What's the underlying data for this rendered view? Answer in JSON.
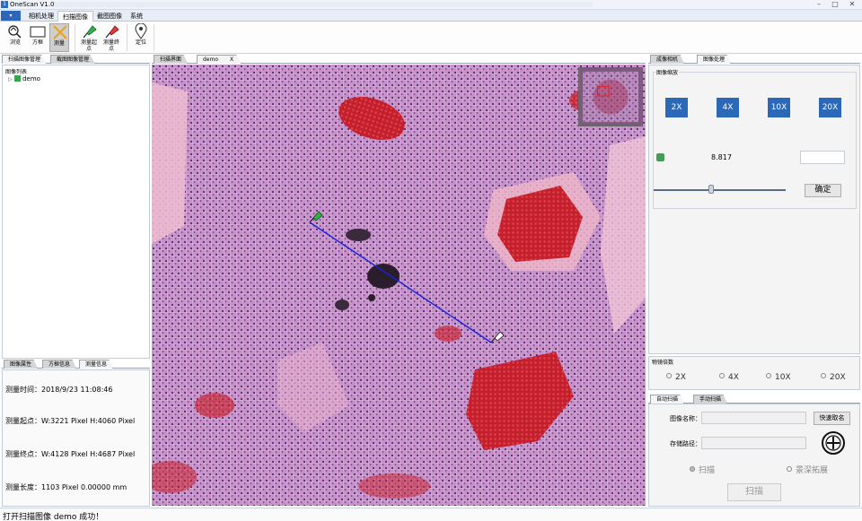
{
  "window": {
    "title": "OneScan V1.0"
  },
  "ribbon": {
    "tabs": [
      "相机处理",
      "扫描图像",
      "截图图像",
      "系统"
    ],
    "active_tab": "扫描图像",
    "tools": [
      {
        "label": "浏览",
        "icon": "browse-icon"
      },
      {
        "label": "方框",
        "icon": "rectangle-icon"
      },
      {
        "label": "测量",
        "icon": "measure-icon"
      },
      {
        "label": "测量起点",
        "icon": "measure-start-pin-icon"
      },
      {
        "label": "测量终点",
        "icon": "measure-end-pin-icon"
      },
      {
        "label": "定位",
        "icon": "location-pin-icon"
      }
    ],
    "active_tool": "测量"
  },
  "left_panel": {
    "tabs": [
      "扫描图像管理",
      "截图图像管理"
    ],
    "tree_header": "图像列表",
    "tree_items": [
      {
        "label": "demo"
      }
    ],
    "info_tabs": [
      "图像属性",
      "方框信息",
      "测量信息"
    ],
    "info": {
      "time": "测量时间：2018/9/23 11:08:46",
      "start": "测量起点：W:3221 Pixel  H:4060 Pixel",
      "end": "测量终点：W:4128 Pixel  H:4687 Pixel",
      "length": "测量长度：1103 Pixel  0.00000 mm"
    }
  },
  "viewer": {
    "tabs": [
      "扫描界面",
      "demo"
    ],
    "close": "X"
  },
  "right_panel": {
    "tabs": [
      "成像相机",
      "图像处理"
    ],
    "zoom_group": "图像缩放",
    "zoom_buttons": [
      "2X",
      "4X",
      "10X",
      "20X"
    ],
    "zoom_value": "8.817",
    "confirm": "确定",
    "objective_group": "物镜倍数",
    "objective_options": [
      "2X",
      "4X",
      "10X",
      "20X"
    ],
    "scan_tabs": [
      "自动扫描",
      "手动扫描"
    ],
    "image_name_label": "图像名称：",
    "quick_name": "快速取名",
    "save_path_label": "存储路径：",
    "mode_options": [
      "扫描",
      "景深拓展"
    ],
    "scan_button": "扫描"
  },
  "status": {
    "text": "打开扫描图像 demo 成功！"
  },
  "colors": {
    "accent": "#2b68b8",
    "measure_line": "#1a22d8"
  }
}
